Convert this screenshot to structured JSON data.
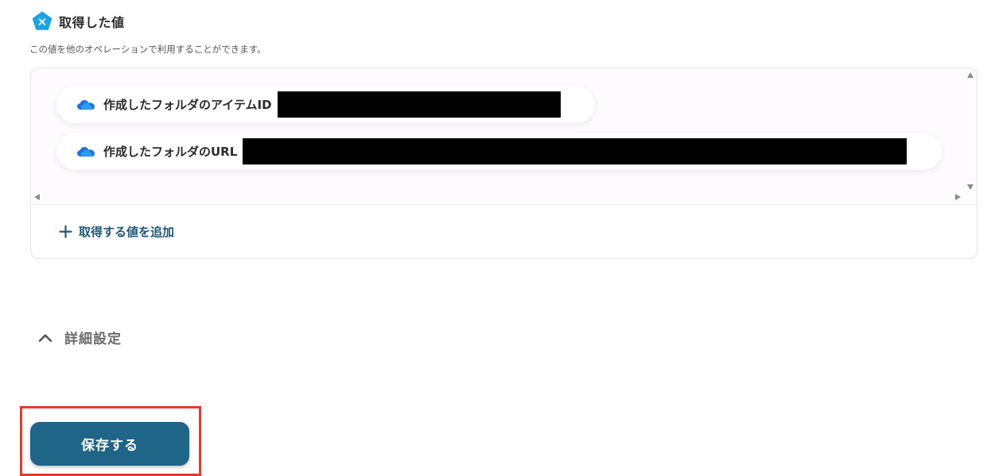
{
  "section": {
    "title": "取得した値",
    "description": "この値を他のオペレーションで利用することができます。",
    "icon": "yoom-pentagon-icon",
    "icon_color": "#1aa3e8"
  },
  "values": [
    {
      "label": "作成したフォルダのアイテムID",
      "icon": "onedrive-cloud-icon",
      "value_redacted": true
    },
    {
      "label": "作成したフォルダのURL",
      "icon": "onedrive-cloud-icon",
      "value_redacted": true
    }
  ],
  "add_value": {
    "label": "取得する値を追加",
    "icon": "plus-icon"
  },
  "advanced": {
    "label": "詳細設定",
    "icon": "chevron-up-icon"
  },
  "save_button": {
    "label": "保存する",
    "color": "#1e6587"
  },
  "highlight_color": "#e53a2b"
}
